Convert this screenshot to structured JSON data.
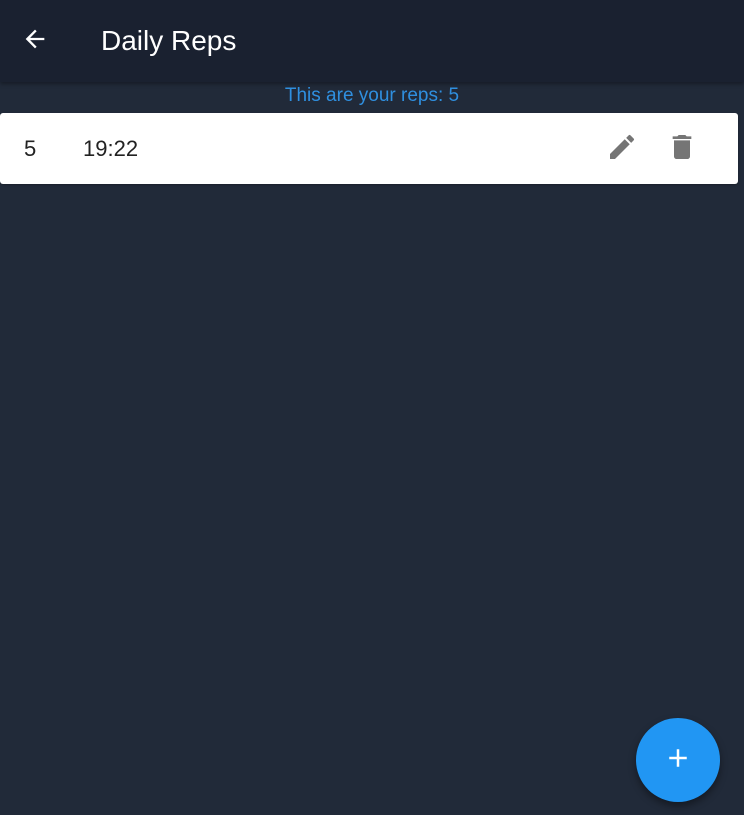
{
  "app_bar": {
    "title": "Daily Reps",
    "back_icon": "arrow-back-icon"
  },
  "summary": {
    "text": "This are your reps: 5"
  },
  "reps": [
    {
      "count": "5",
      "time": "19:22",
      "edit_icon": "pencil-icon",
      "delete_icon": "trash-icon"
    }
  ],
  "fab": {
    "icon": "plus-icon"
  },
  "colors": {
    "background": "#212a39",
    "app_bar": "#1a2130",
    "accent": "#2196f3",
    "summary_text": "#2f8fdf",
    "card": "#ffffff",
    "icon_gray": "#757575"
  }
}
